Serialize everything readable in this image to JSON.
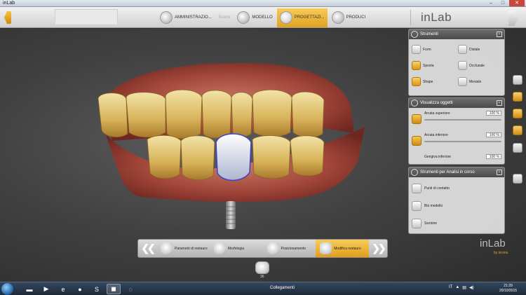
{
  "window": {
    "title": "inLab",
    "minimize": "–",
    "maximize": "□",
    "close": "✕"
  },
  "topbar": {
    "phases": [
      {
        "label": "AMMINISTRAZIO...",
        "state": "normal"
      },
      {
        "label": "Scans",
        "state": "disabled"
      },
      {
        "label": "MODELLO",
        "state": "normal"
      },
      {
        "label": "PROGETTAZI...",
        "state": "active"
      },
      {
        "label": "PRODUCI",
        "state": "normal"
      }
    ],
    "brand": "inLab"
  },
  "strumenti": {
    "title": "Strumenti",
    "tools": [
      "Form",
      "Distale",
      "Sposta",
      "Occlusale",
      "Shape",
      "Mesiale"
    ]
  },
  "visualizza": {
    "title": "Visualizza oggetti",
    "objects": [
      {
        "label": "Arcata superiore",
        "value": "100 %"
      },
      {
        "label": "Arcata inferiore",
        "value": "100 %"
      },
      {
        "label": "Gengiva inferiore",
        "value": "100 %"
      }
    ]
  },
  "analisi": {
    "title": "Strumenti per Analisi in corso",
    "items": [
      "Punti di contatto",
      "Bio modello",
      "Sezione"
    ]
  },
  "steps": {
    "prev": "❮❮",
    "next": "❯❯",
    "items": [
      {
        "label": "Parametri di restauro",
        "state": "normal"
      },
      {
        "label": "Morfologia",
        "state": "normal"
      },
      {
        "label": "Posizionamento",
        "state": "normal"
      },
      {
        "label": "Modifica restauro",
        "state": "active"
      }
    ]
  },
  "brand_bottom": {
    "name": "inLab",
    "sub": "by sirona"
  },
  "bottom_tooth_label": "36",
  "taskbar": {
    "center_text": "Collegamenti",
    "tray_lang": "IT",
    "time": "21:29",
    "date": "20/10/2015"
  },
  "colors": {
    "accent": "#e0a21f",
    "restoration": "#c9d1e6"
  }
}
